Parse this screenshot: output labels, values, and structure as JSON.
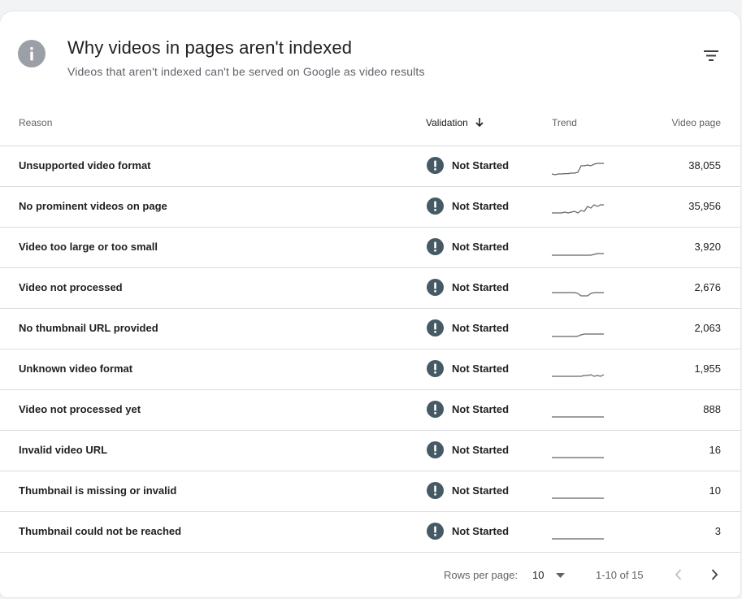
{
  "header": {
    "title": "Why videos in pages aren't indexed",
    "subtitle": "Videos that aren't indexed can't be served on Google as video results"
  },
  "columns": {
    "reason": "Reason",
    "validation": "Validation",
    "trend": "Trend",
    "video_page": "Video page"
  },
  "rows": [
    {
      "reason": "Unsupported video format",
      "validation": "Not Started",
      "count": "38,055",
      "trend": [
        0.1,
        0.05,
        0.1,
        0.1,
        0.12,
        0.12,
        0.15,
        0.15,
        0.2,
        0.6,
        0.6,
        0.65,
        0.6,
        0.7,
        0.75,
        0.75,
        0.75
      ]
    },
    {
      "reason": "No prominent videos on page",
      "validation": "Not Started",
      "count": "35,956",
      "trend": [
        0.2,
        0.2,
        0.2,
        0.2,
        0.25,
        0.2,
        0.25,
        0.3,
        0.2,
        0.35,
        0.3,
        0.6,
        0.5,
        0.7,
        0.6,
        0.7,
        0.7
      ]
    },
    {
      "reason": "Video too large or too small",
      "validation": "Not Started",
      "count": "3,920",
      "trend": [
        0.1,
        0.1,
        0.1,
        0.1,
        0.1,
        0.1,
        0.1,
        0.1,
        0.1,
        0.1,
        0.1,
        0.1,
        0.1,
        0.15,
        0.2,
        0.2,
        0.2
      ]
    },
    {
      "reason": "Video not processed",
      "validation": "Not Started",
      "count": "2,676",
      "trend": [
        0.3,
        0.3,
        0.3,
        0.3,
        0.3,
        0.3,
        0.3,
        0.3,
        0.25,
        0.1,
        0.1,
        0.1,
        0.25,
        0.3,
        0.3,
        0.3,
        0.3
      ]
    },
    {
      "reason": "No thumbnail URL provided",
      "validation": "Not Started",
      "count": "2,063",
      "trend": [
        0.1,
        0.1,
        0.1,
        0.1,
        0.1,
        0.1,
        0.1,
        0.1,
        0.12,
        0.2,
        0.25,
        0.25,
        0.25,
        0.25,
        0.25,
        0.25,
        0.25
      ]
    },
    {
      "reason": "Unknown video format",
      "validation": "Not Started",
      "count": "1,955",
      "trend": [
        0.15,
        0.15,
        0.15,
        0.15,
        0.15,
        0.15,
        0.15,
        0.15,
        0.15,
        0.15,
        0.2,
        0.2,
        0.25,
        0.15,
        0.2,
        0.15,
        0.25
      ]
    },
    {
      "reason": "Video not processed yet",
      "validation": "Not Started",
      "count": "888",
      "trend": [
        0.15,
        0.15,
        0.15,
        0.15,
        0.15,
        0.15,
        0.15,
        0.15,
        0.15,
        0.15,
        0.15,
        0.15,
        0.15,
        0.15,
        0.15,
        0.15,
        0.15
      ]
    },
    {
      "reason": "Invalid video URL",
      "validation": "Not Started",
      "count": "16",
      "trend": [
        0.15,
        0.15,
        0.15,
        0.15,
        0.15,
        0.15,
        0.15,
        0.15,
        0.15,
        0.15,
        0.15,
        0.15,
        0.15,
        0.15,
        0.15,
        0.15,
        0.15
      ]
    },
    {
      "reason": "Thumbnail is missing or invalid",
      "validation": "Not Started",
      "count": "10",
      "trend": [
        0.15,
        0.15,
        0.15,
        0.15,
        0.15,
        0.15,
        0.15,
        0.15,
        0.15,
        0.15,
        0.15,
        0.15,
        0.15,
        0.15,
        0.15,
        0.15,
        0.15
      ]
    },
    {
      "reason": "Thumbnail could not be reached",
      "validation": "Not Started",
      "count": "3",
      "trend": [
        0.15,
        0.15,
        0.15,
        0.15,
        0.15,
        0.15,
        0.15,
        0.15,
        0.15,
        0.15,
        0.15,
        0.15,
        0.15,
        0.15,
        0.15,
        0.15,
        0.15
      ]
    }
  ],
  "footer": {
    "rows_per_page_label": "Rows per page:",
    "rows_per_page_value": "10",
    "range": "1-10 of 15"
  },
  "icons": {
    "info": "info-icon",
    "filter": "filter-icon",
    "sort": "arrow-down-icon",
    "status": "exclamation-circle-icon",
    "prev": "chevron-left-icon",
    "next": "chevron-right-icon",
    "dropdown": "caret-down-icon"
  },
  "colors": {
    "status_icon": "#455a64",
    "trend_line": "#5f6368",
    "info_icon": "#9aa0a6"
  }
}
